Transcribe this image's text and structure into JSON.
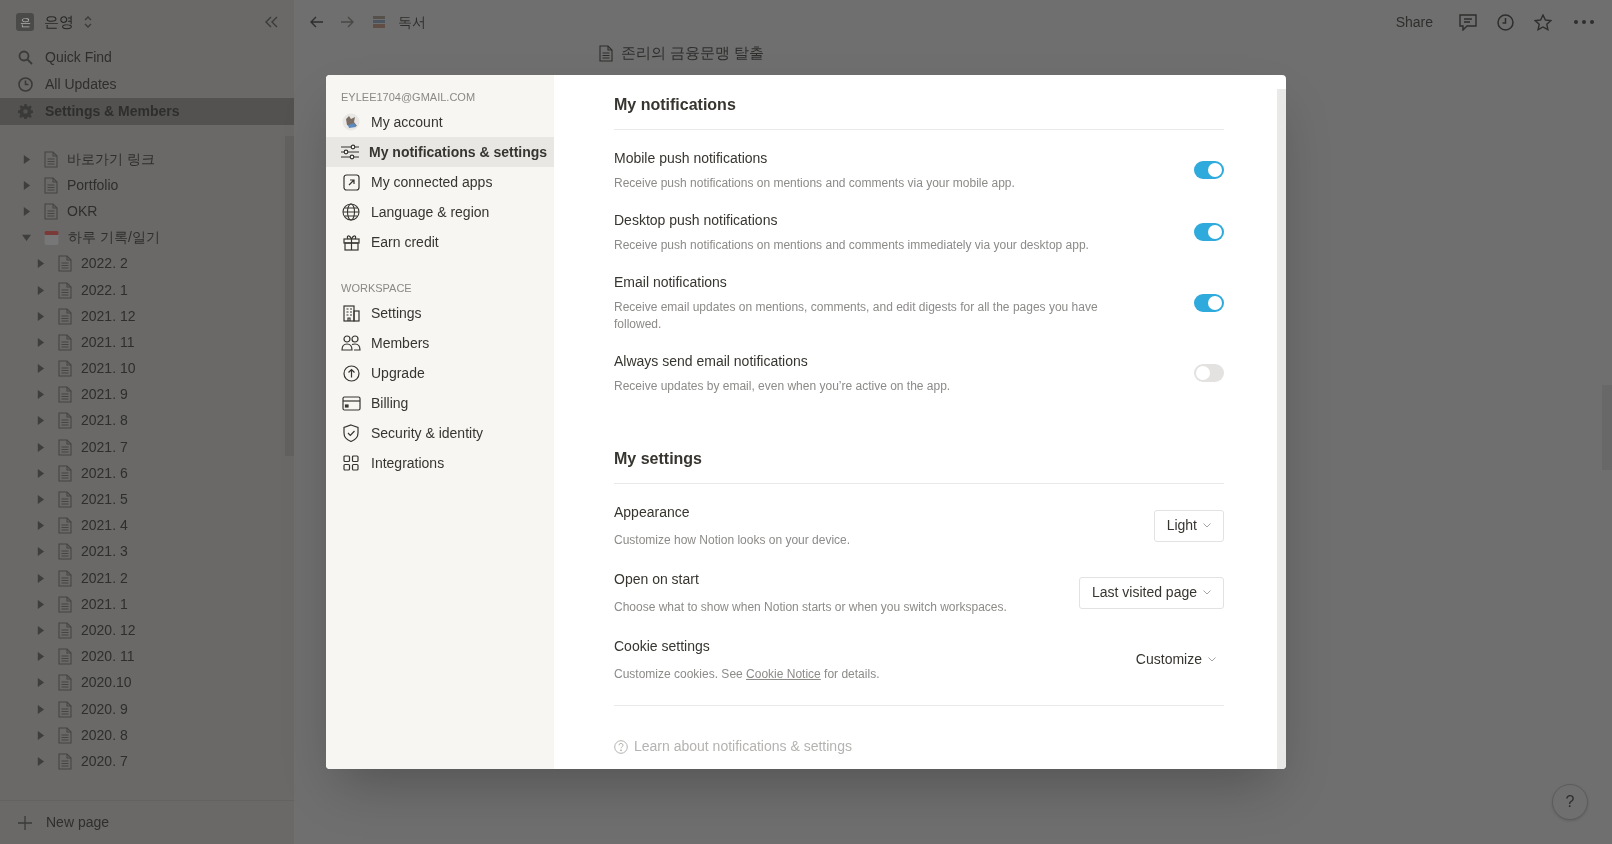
{
  "sidebar": {
    "workspace": {
      "avatar": "은",
      "name": "은영"
    },
    "nav": [
      {
        "label": "Quick Find",
        "selected": false
      },
      {
        "label": "All Updates",
        "selected": false
      },
      {
        "label": "Settings & Members",
        "selected": true
      }
    ],
    "tree": [
      {
        "label": "바로가기 링크",
        "kind": "page",
        "expanded": false
      },
      {
        "label": "Portfolio",
        "kind": "page",
        "expanded": false
      },
      {
        "label": "OKR",
        "kind": "page",
        "expanded": false
      },
      {
        "label": "하루 기록/일기",
        "kind": "calendar",
        "expanded": true,
        "children": [
          {
            "label": "2022. 2",
            "kind": "page",
            "expanded": false
          },
          {
            "label": "2022. 1",
            "kind": "page",
            "expanded": false
          },
          {
            "label": "2021. 12",
            "kind": "page",
            "expanded": false
          },
          {
            "label": "2021. 11",
            "kind": "page",
            "expanded": false
          },
          {
            "label": "2021. 10",
            "kind": "page",
            "expanded": false
          },
          {
            "label": "2021. 9",
            "kind": "page",
            "expanded": false
          },
          {
            "label": "2021. 8",
            "kind": "page",
            "expanded": false
          },
          {
            "label": "2021. 7",
            "kind": "page",
            "expanded": false
          },
          {
            "label": "2021. 6",
            "kind": "page",
            "expanded": false
          },
          {
            "label": "2021. 5",
            "kind": "page",
            "expanded": false
          },
          {
            "label": "2021. 4",
            "kind": "page",
            "expanded": false
          },
          {
            "label": "2021. 3",
            "kind": "page",
            "expanded": false
          },
          {
            "label": "2021. 2",
            "kind": "page",
            "expanded": false
          },
          {
            "label": "2021. 1",
            "kind": "page",
            "expanded": false
          },
          {
            "label": "2020. 12",
            "kind": "page",
            "expanded": false
          },
          {
            "label": "2020. 11",
            "kind": "page",
            "expanded": false
          },
          {
            "label": "2020.10",
            "kind": "page",
            "expanded": false
          },
          {
            "label": "2020. 9",
            "kind": "page",
            "expanded": false
          },
          {
            "label": "2020. 8",
            "kind": "page",
            "expanded": false
          },
          {
            "label": "2020. 7",
            "kind": "page",
            "expanded": false
          }
        ]
      }
    ],
    "new_page": "New page"
  },
  "topbar": {
    "breadcrumb": "독서",
    "share": "Share"
  },
  "page": {
    "title": "존리의 금융문맹 탈출"
  },
  "modal": {
    "account_email": "EYLEE1704@GMAIL.COM",
    "account_items": [
      {
        "label": "My account",
        "selected": false
      },
      {
        "label": "My notifications & settings",
        "selected": true
      },
      {
        "label": "My connected apps",
        "selected": false
      },
      {
        "label": "Language & region",
        "selected": false
      },
      {
        "label": "Earn credit",
        "selected": false
      }
    ],
    "workspace_heading": "WORKSPACE",
    "workspace_items": [
      {
        "label": "Settings",
        "selected": false
      },
      {
        "label": "Members",
        "selected": false
      },
      {
        "label": "Upgrade",
        "selected": false
      },
      {
        "label": "Billing",
        "selected": false
      },
      {
        "label": "Security & identity",
        "selected": false
      },
      {
        "label": "Integrations",
        "selected": false
      }
    ],
    "notifications": {
      "title": "My notifications",
      "rows": [
        {
          "title": "Mobile push notifications",
          "description": "Receive push notifications on mentions and comments via your mobile app.",
          "on": true
        },
        {
          "title": "Desktop push notifications",
          "description": "Receive push notifications on mentions and comments immediately via your desktop app.",
          "on": true
        },
        {
          "title": "Email notifications",
          "description": "Receive email updates on mentions, comments, and edit digests for all the pages you have followed.",
          "on": true
        },
        {
          "title": "Always send email notifications",
          "description": "Receive updates by email, even when you’re active on the app.",
          "on": false
        }
      ]
    },
    "settings": {
      "title": "My settings",
      "rows": [
        {
          "title": "Appearance",
          "description": "Customize how Notion looks on your device.",
          "control": {
            "kind": "dropdown",
            "value": "Light"
          }
        },
        {
          "title": "Open on start",
          "description": "Choose what to show when Notion starts or when you switch workspaces.",
          "control": {
            "kind": "dropdown",
            "value": "Last visited page"
          }
        },
        {
          "title": "Cookie settings",
          "description": "Customize cookies. See ",
          "link": "Cookie Notice",
          "description_after": " for details.",
          "control": {
            "kind": "menu",
            "value": "Customize"
          }
        }
      ]
    },
    "help_link": "Learn about notifications & settings"
  },
  "help_button": "?"
}
